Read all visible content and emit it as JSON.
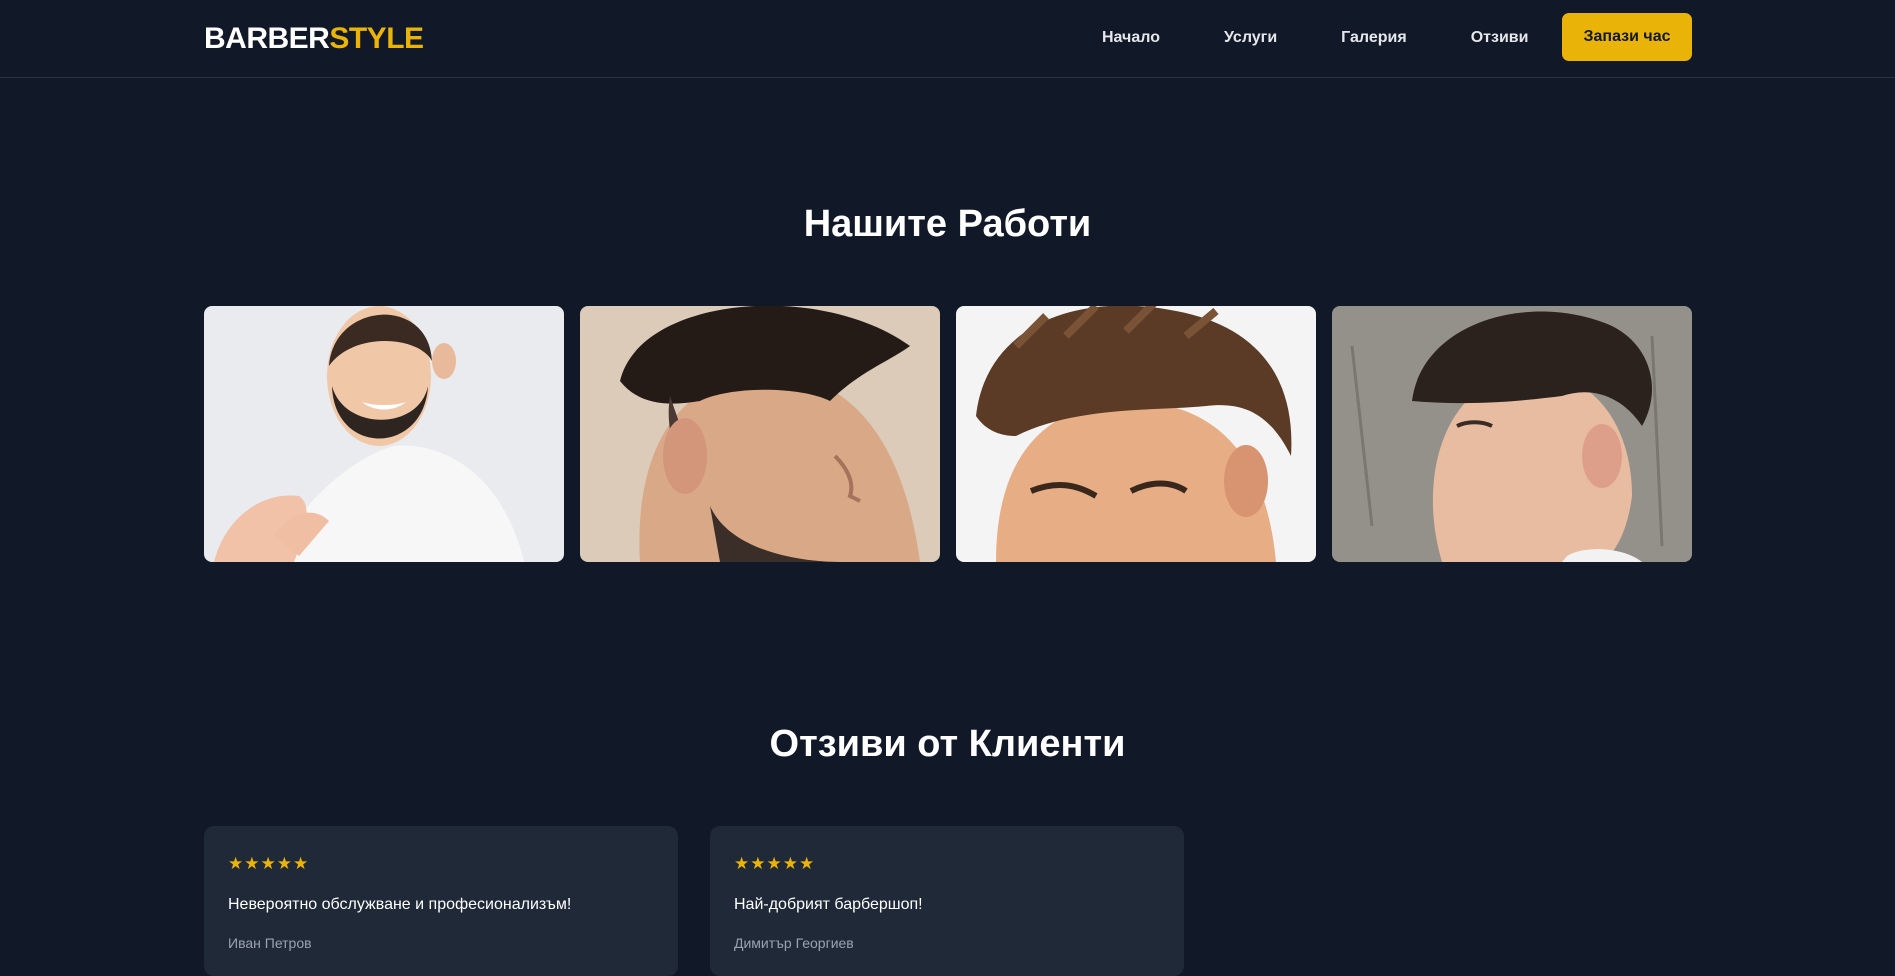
{
  "header": {
    "logo_part1": "BARBER",
    "logo_part2": "STYLE",
    "nav": [
      {
        "label": "Начало"
      },
      {
        "label": "Услуги"
      },
      {
        "label": "Галерия"
      },
      {
        "label": "Отзиви"
      }
    ],
    "cta_label": "Запази час"
  },
  "gallery": {
    "title": "Нашите Работи",
    "photos": [
      {
        "icon": "smiling-bearded-man-photo"
      },
      {
        "icon": "fade-haircut-side-photo"
      },
      {
        "icon": "textured-crop-haircut-photo"
      },
      {
        "icon": "mid-fade-profile-photo"
      }
    ]
  },
  "reviews": {
    "title": "Отзиви от Клиенти",
    "items": [
      {
        "stars": "★★★★★",
        "text": "Невероятно обслужване и професионализъм!",
        "author": "Иван Петров"
      },
      {
        "stars": "★★★★★",
        "text": "Най-добрият барбершоп!",
        "author": "Димитър Георгиев"
      }
    ]
  },
  "colors": {
    "background": "#111827",
    "accent": "#eab308",
    "card": "#1f2937"
  }
}
